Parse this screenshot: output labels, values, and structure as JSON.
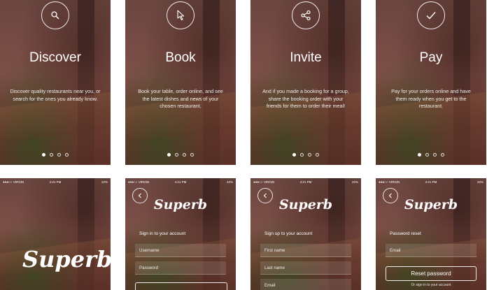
{
  "onboarding": [
    {
      "title": "Discover",
      "description": "Discover quality restaurants near you, or search for the ones you already know.",
      "icon": "search-icon"
    },
    {
      "title": "Book",
      "description": "Book your table, order online, and see the latest dishes and news of your chosen restaurant.",
      "icon": "cursor-icon"
    },
    {
      "title": "Invite",
      "description": "And if you made a booking for a group, share the booking order with your friends for them to order their meal!",
      "icon": "share-icon"
    },
    {
      "title": "Pay",
      "description": "Pay for your orders online and have them ready when you get to the restaurant.",
      "icon": "check-icon"
    }
  ],
  "status_bar": {
    "carrier": "●●●○○ VIRGIN",
    "time": "4:21 PM",
    "battery": "22%"
  },
  "app": {
    "logo": "Superb"
  },
  "signin": {
    "heading": "Sign in to your account",
    "username_placeholder": "Username",
    "password_placeholder": "Password"
  },
  "signup": {
    "heading": "Sign up to your account",
    "first_name_placeholder": "First name",
    "last_name_placeholder": "Last name",
    "email_placeholder": "Email"
  },
  "reset": {
    "heading": "Password reset",
    "email_placeholder": "Email",
    "button_label": "Reset password",
    "signin_link": "Or sign in to your account"
  }
}
